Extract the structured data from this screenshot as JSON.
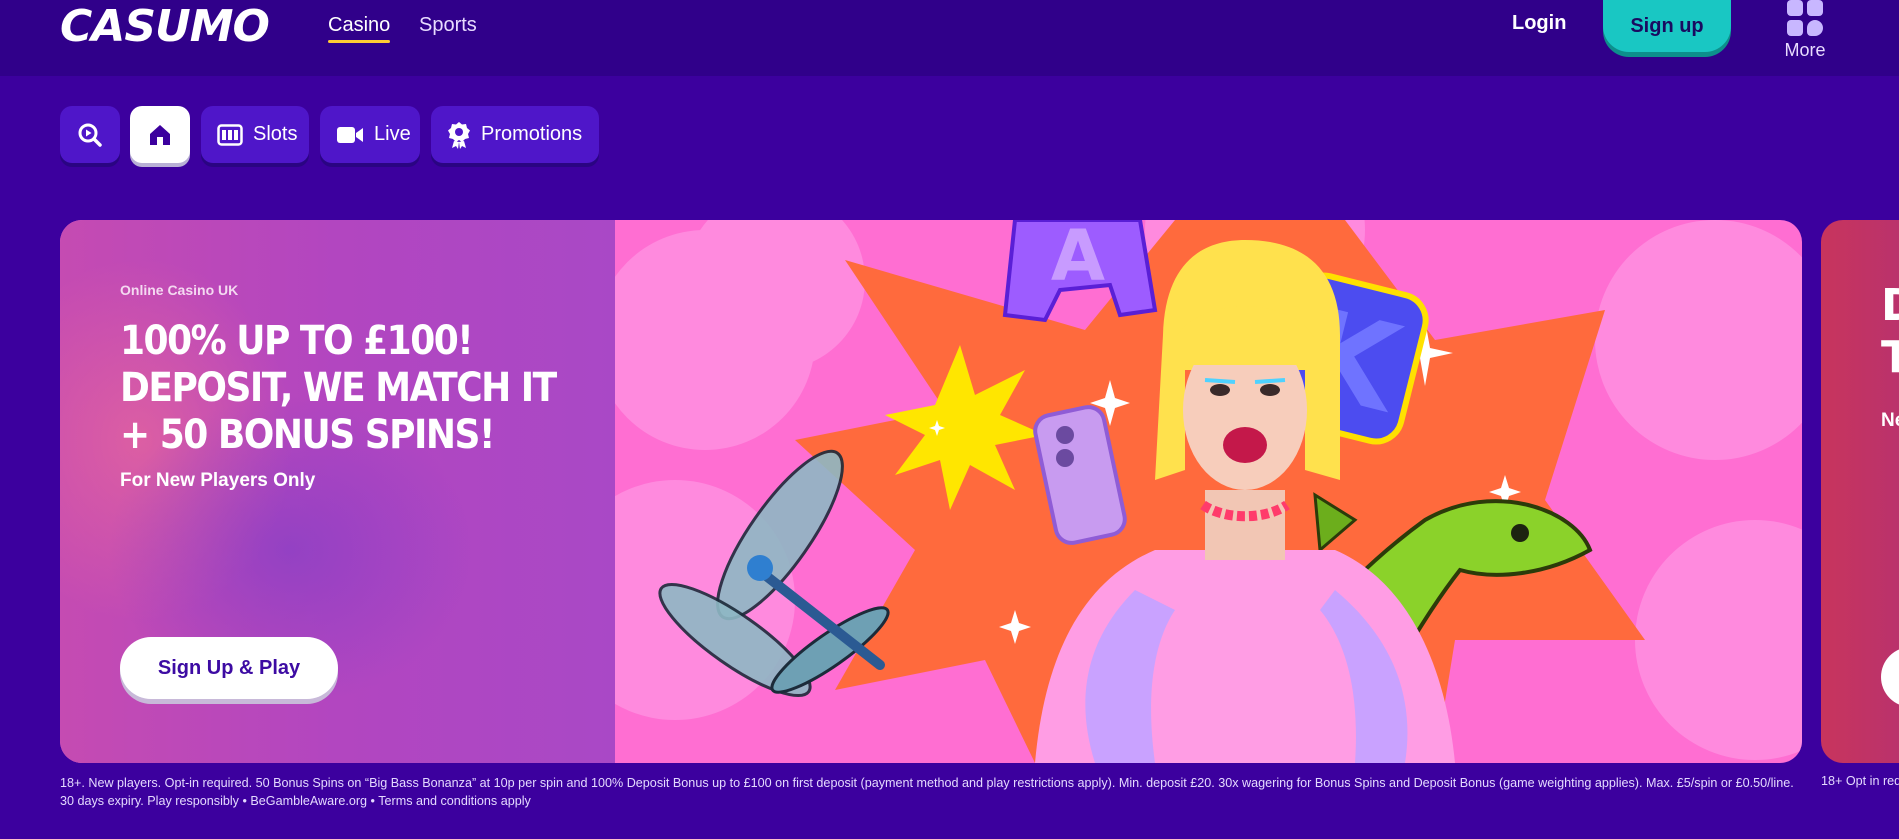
{
  "header": {
    "logo": "CASUMO",
    "nav": [
      {
        "label": "Casino",
        "active": true
      },
      {
        "label": "Sports",
        "active": false
      }
    ],
    "login_label": "Login",
    "signup_label": "Sign up",
    "more_label": "More"
  },
  "categories": [
    {
      "name": "search",
      "label": "",
      "icon": "search-icon"
    },
    {
      "name": "home",
      "label": "",
      "icon": "home-icon"
    },
    {
      "name": "slots",
      "label": "Slots",
      "icon": "slot-machine-icon"
    },
    {
      "name": "live",
      "label": "Live",
      "icon": "video-camera-icon"
    },
    {
      "name": "promotions",
      "label": "Promotions",
      "icon": "award-badge-icon"
    }
  ],
  "hero": {
    "kicker": "Online Casino UK",
    "title": "100% UP TO £100! DEPOSIT, WE MATCH IT + 50 BONUS SPINS!",
    "subtitle": "For New Players Only",
    "cta_label": "Sign Up & Play",
    "art_letters": [
      "A",
      "K"
    ]
  },
  "next_slide": {
    "title_lines": [
      "D",
      "T"
    ],
    "subtitle": "Ne",
    "terms": "18+ Opt in req"
  },
  "terms": "18+. New players. Opt-in required. 50 Bonus Spins on “Big Bass Bonanza” at 10p per spin and 100% Deposit Bonus up to £100 on first deposit (payment method and play restrictions apply). Min. deposit £20. 30x wagering for Bonus Spins and Deposit Bonus (game weighting applies). Max. £5/spin or £0.50/line. 30 days expiry. Play responsibly • BeGambleAware.org • Terms and conditions apply",
  "colors": {
    "background": "#3c009e",
    "header": "#30008a",
    "accent_teal": "#19c7c3",
    "nav_underline": "#ffcc33",
    "hero_pink": "#ff6ed2"
  }
}
